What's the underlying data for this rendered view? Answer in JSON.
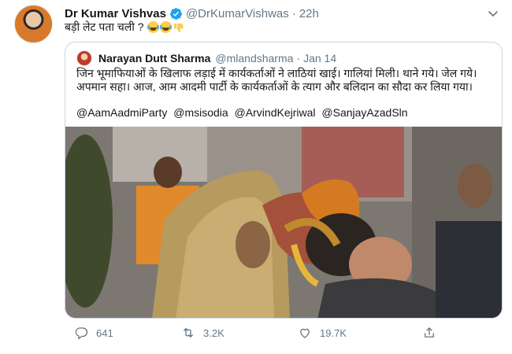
{
  "tweet": {
    "display_name": "Dr Kumar Vishvas",
    "handle": "@DrKumarVishwas",
    "separator": "·",
    "time": "22h",
    "text": "बड़ी लेट पता चली ?",
    "emojis": [
      "face-with-tears-of-joy",
      "face-with-tears-of-joy",
      "thumbs-down"
    ]
  },
  "quoted_tweet": {
    "display_name": "Narayan Dutt Sharma",
    "handle": "@mlandsharma",
    "separator": "·",
    "time": "Jan 14",
    "text": "जिन भूमाफियाओं के खिलाफ लड़ाई में कार्यकर्ताओं ने लाठियां खाई। गालियां मिली। थाने गये। जेल गये। अपमान सहा। आज, आम आदमी पार्टी के कार्यकर्ताओं के त्याग और बलिदान का सौदा कर लिया गया।",
    "mentions": [
      "@AamAadmiParty",
      "@msisodia",
      "@ArvindKejriwal",
      "@SanjayAzadSln"
    ]
  },
  "actions": {
    "reply_count": "641",
    "retweet_count": "3.2K",
    "like_count": "19.7K"
  },
  "colors": {
    "text_primary": "#14171a",
    "text_secondary": "#657786",
    "border": "#ccd6dd",
    "verified_blue": "#1da1f2"
  }
}
